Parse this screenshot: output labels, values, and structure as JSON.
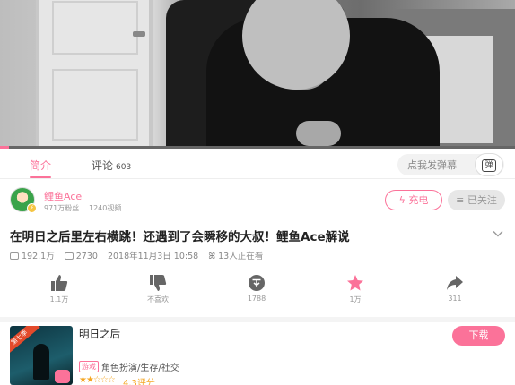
{
  "player": {
    "progress_fraction": 0.017
  },
  "tabs": [
    {
      "label": "简介",
      "count": ""
    },
    {
      "label": "评论",
      "count": "603"
    }
  ],
  "danmaku": {
    "placeholder": "点我发弹幕",
    "button_icon": "弹"
  },
  "uploader": {
    "name": "鲤鱼Ace",
    "fans": "971万粉丝",
    "videos": "1240视频",
    "charge_label": "充电",
    "follow_label": "已关注"
  },
  "video": {
    "title": "在明日之后里左右横跳！还遇到了会瞬移的大叔！鲤鱼Ace解说",
    "views": "192.1万",
    "danmaku_count": "2730",
    "date": "2018年11月3日 10:58",
    "watching": "13人正在看"
  },
  "actions": [
    {
      "icon": "thumb-up-icon",
      "label": "1.1万"
    },
    {
      "icon": "thumb-down-icon",
      "label": "不喜欢"
    },
    {
      "icon": "coin-icon",
      "label": "1788"
    },
    {
      "icon": "star-icon",
      "label": "1万"
    },
    {
      "icon": "share-icon",
      "label": "311"
    }
  ],
  "game": {
    "name": "明日之后",
    "tag": "游戏",
    "genre": "角色扮演/生存/社交",
    "rating": "4.3评分",
    "download_label": "下载",
    "cover_ribbon": "第七季"
  },
  "colors": {
    "accent": "#fb7299",
    "star": "#f5a623"
  }
}
